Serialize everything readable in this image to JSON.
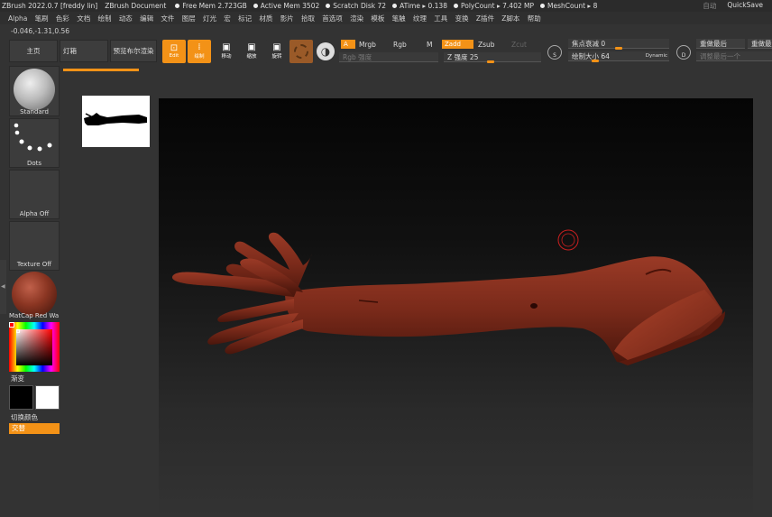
{
  "titlebar": {
    "app": "ZBrush 2022.0.7 [freddy lin]",
    "doc": "ZBrush Document",
    "stats": [
      "Free Mem 2.723GB",
      "Active Mem 3502",
      "Scratch Disk 72",
      "ATime ▸ 0.138",
      "PolyCount ▸ 7.402 MP",
      "MeshCount ▸ 8"
    ],
    "auto": "自动",
    "quicksave": "QuickSave"
  },
  "menus": [
    "Alpha",
    "笔刷",
    "色彩",
    "文档",
    "绘制",
    "动态",
    "编辑",
    "文件",
    "图层",
    "灯光",
    "宏",
    "标记",
    "材质",
    "影片",
    "拾取",
    "首选项",
    "渲染",
    "模板",
    "笔触",
    "纹理",
    "工具",
    "变换",
    "Z插件",
    "Z脚本",
    "帮助"
  ],
  "coords": "-0.046,-1.31,0.56",
  "shelf": {
    "home": "主页",
    "lightbox": "灯箱",
    "bpr": "预览布尔渲染",
    "edit": "Edit",
    "draw": "绘制",
    "move": "移动",
    "scale": "缩放",
    "rotate": "旋转",
    "a": "A",
    "mrgb": "Mrgb",
    "rgb": "Rgb",
    "m": "M",
    "rgb_intensity": "Rgb 强度",
    "zadd": "Zadd",
    "zsub": "Zsub",
    "zcut": "Zcut",
    "z_intensity": "Z 强度 25",
    "focal_shift": "焦点衰减 0",
    "draw_size": "绘制大小 64",
    "dynamic": "Dynamic",
    "s_label": "S",
    "d_label": "D",
    "redo_last": "重做最后",
    "redo_last2": "重做最后",
    "adjust_last": "调整最后一个"
  },
  "left": {
    "brush": "Standard",
    "stroke": "Dots",
    "alpha": "Alpha Off",
    "texture": "Texture Off",
    "material": "MatCap Red Wa",
    "gradient": "渐变",
    "switch_color": "切换颜色",
    "alternate": "交替"
  },
  "colors": {
    "accent": "#f39217",
    "flesh": "#7a2a1a",
    "bg": "#333333"
  }
}
